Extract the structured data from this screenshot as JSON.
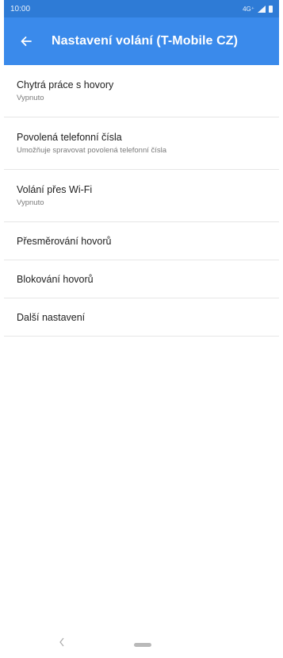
{
  "status_bar": {
    "time": "10:00",
    "network": "4G⁺"
  },
  "app_bar": {
    "title": "Nastavení volání (T-Mobile CZ)"
  },
  "settings": [
    {
      "title": "Chytrá práce s hovory",
      "summary": "Vypnuto"
    },
    {
      "title": "Povolená telefonní čísla",
      "summary": "Umožňuje spravovat povolená telefonní čísla"
    },
    {
      "title": "Volání přes Wi-Fi",
      "summary": "Vypnuto"
    },
    {
      "title": "Přesměrování hovorů"
    },
    {
      "title": "Blokování hovorů"
    },
    {
      "title": "Další nastavení"
    }
  ],
  "colors": {
    "status_bar": "#2e7bd6",
    "app_bar": "#3a8aeb"
  },
  "icons": {
    "back": "arrow-left",
    "nav_back": "chevron-left",
    "nav_home": "home-pill"
  }
}
